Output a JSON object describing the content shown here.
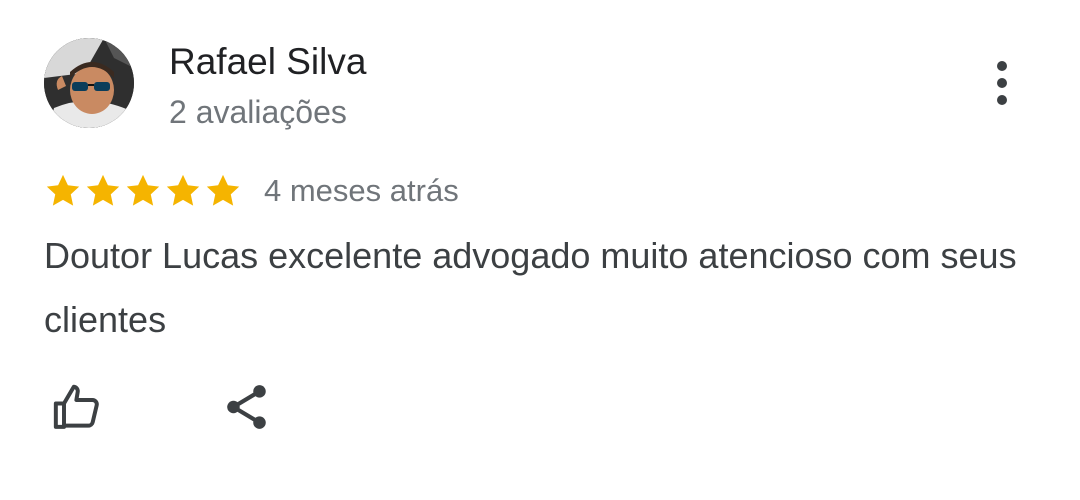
{
  "review": {
    "author_name": "Rafael Silva",
    "author_meta": "2 avaliações",
    "rating": 5,
    "rating_max": 5,
    "timestamp": "4 meses atrás",
    "text": "Doutor Lucas excelente advogado muito atencioso com seus clientes"
  },
  "icons": {
    "more": "more-vert-icon",
    "star": "star-icon",
    "like": "thumb-up-icon",
    "share": "share-icon"
  },
  "colors": {
    "star": "#F5B400",
    "name": "#202124",
    "secondary": "#70757A",
    "body": "#3C4043",
    "icon": "#3C4043"
  }
}
